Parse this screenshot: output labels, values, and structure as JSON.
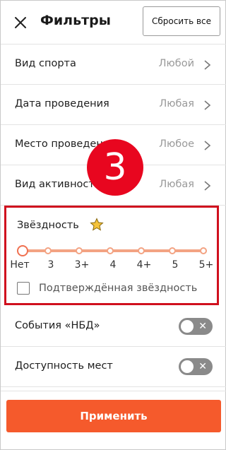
{
  "header": {
    "title": "Фильтры",
    "reset_label": "Сбросить все",
    "close_icon": "close-icon"
  },
  "filters": [
    {
      "label": "Вид спорта",
      "value": "Любой"
    },
    {
      "label": "Дата проведения",
      "value": "Любая"
    },
    {
      "label": "Место проведения",
      "value": "Любое"
    },
    {
      "label": "Вид активности",
      "value": "Любая"
    }
  ],
  "badge": {
    "text": "3",
    "color": "#e8061f"
  },
  "stars": {
    "title": "Звёздность",
    "icon": "star-icon",
    "options": [
      "Нет",
      "3",
      "3+",
      "4",
      "4+",
      "5",
      "5+"
    ],
    "selected": "Нет",
    "verified_label": "Подтверждённая звёздность",
    "verified_checked": false
  },
  "toggles": [
    {
      "label": "События «НБД»",
      "on": false
    },
    {
      "label": "Доступность мест",
      "on": false
    }
  ],
  "apply_label": "Применить",
  "colors": {
    "accent": "#f55a2c",
    "highlight_border": "#d0101e",
    "slider_track": "#f3a383"
  }
}
